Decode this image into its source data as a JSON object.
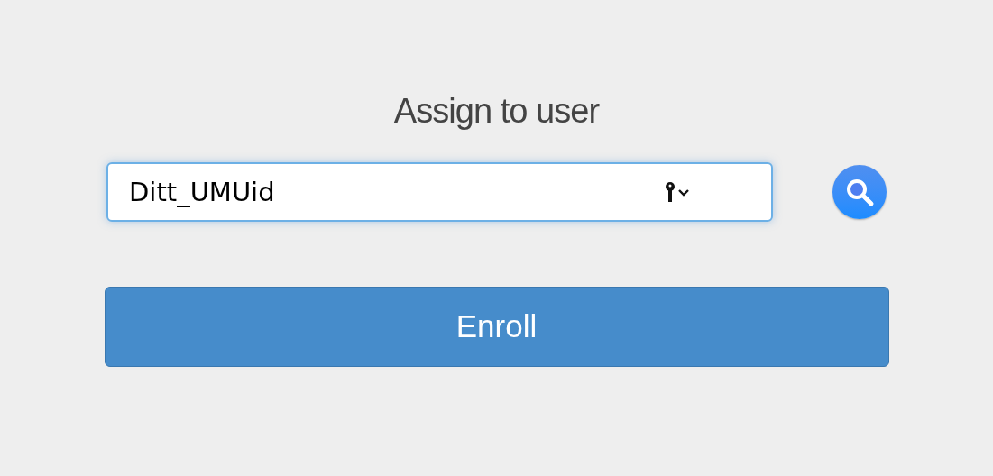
{
  "heading": "Assign to user",
  "user_field": {
    "value": "Ditt_UMUid",
    "focused": true
  },
  "enroll_button": {
    "label": "Enroll"
  }
}
